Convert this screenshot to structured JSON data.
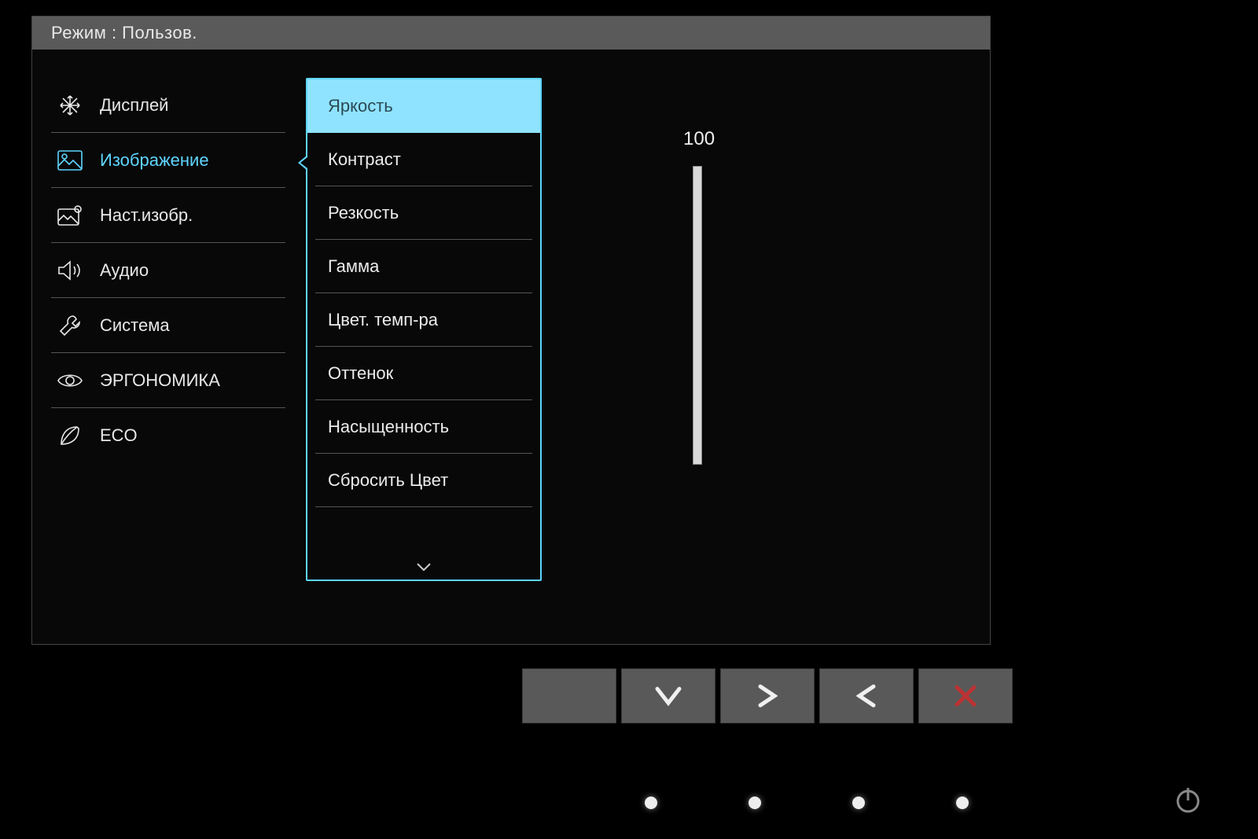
{
  "header": {
    "mode_label": "Режим : Пользов."
  },
  "sidebar": {
    "items": [
      {
        "label": "Дисплей"
      },
      {
        "label": "Изображение"
      },
      {
        "label": "Наст.изобр."
      },
      {
        "label": "Аудио"
      },
      {
        "label": "Система"
      },
      {
        "label": "ЭРГОНОМИКА"
      },
      {
        "label": "ECO"
      }
    ],
    "active_index": 1
  },
  "submenu": {
    "items": [
      {
        "label": "Яркость"
      },
      {
        "label": "Контраст"
      },
      {
        "label": "Резкость"
      },
      {
        "label": "Гамма"
      },
      {
        "label": "Цвет. темп-ра"
      },
      {
        "label": "Оттенок"
      },
      {
        "label": "Насыщенность"
      },
      {
        "label": "Сбросить Цвет"
      }
    ],
    "selected_index": 0
  },
  "value": {
    "number": "100",
    "percent": 100
  },
  "colors": {
    "accent": "#5fd5ff"
  }
}
